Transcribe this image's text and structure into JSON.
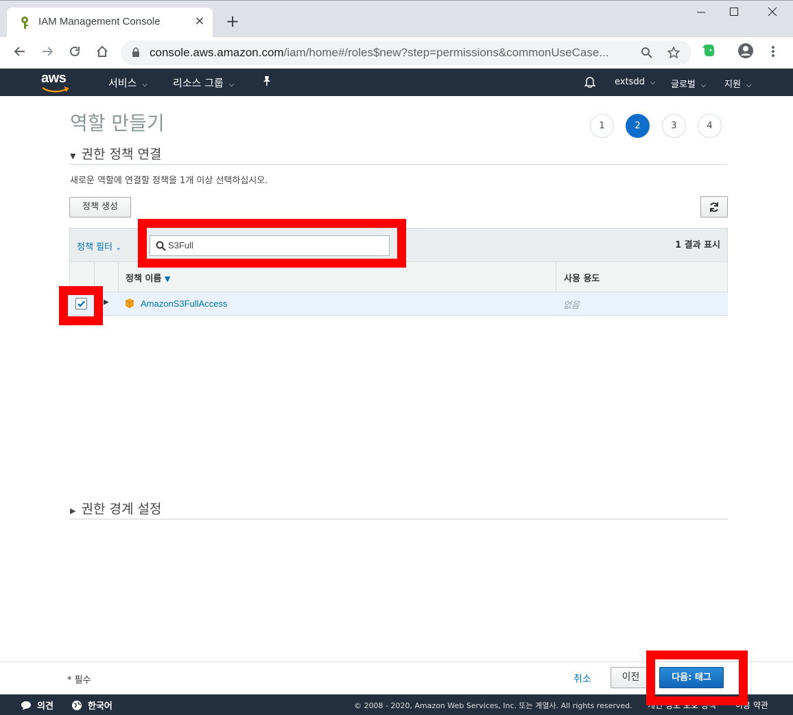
{
  "browser": {
    "tab_title": "IAM Management Console",
    "tab_close": "×",
    "new_tab": "+",
    "url_host": "console.aws.amazon.com",
    "url_path": "/iam/home#/roles$new?step=permissions&commonUseCase..."
  },
  "awsnav": {
    "logo": "aws",
    "services": "서비스",
    "resource_groups": "리소스 그룹",
    "account": "extsdd",
    "region": "글로벌",
    "support": "지원"
  },
  "page": {
    "title": "역할 만들기",
    "steps": [
      "1",
      "2",
      "3",
      "4"
    ],
    "active_step": 2,
    "section_permissions": "권한 정책 연결",
    "description": "새로운 역할에 연결할 정책을 1개 이상 선택하십시오.",
    "create_policy_button": "정책 생성",
    "filter_label": "정책 필터",
    "search_value": "S3Full",
    "result_count": "1 결과 표시",
    "columns": {
      "name": "정책 이름",
      "usage": "사용 용도"
    },
    "rows": [
      {
        "name": "AmazonS3FullAccess",
        "usage": "없음",
        "checked": true
      }
    ],
    "section_boundary": "권한 경계 설정"
  },
  "footer": {
    "required": "* 필수",
    "cancel": "취소",
    "previous": "이전",
    "next": "다음: 태그"
  },
  "bottombar": {
    "feedback": "의견",
    "language": "한국어",
    "copyright": "© 2008 - 2020, Amazon Web Services, Inc. 또는 계열사. All rights reserved.",
    "privacy": "개인 정보 보호 정책",
    "terms": "이용 약관"
  },
  "colors": {
    "aws_nav": "#232f3e",
    "primary_blue": "#0f6ec9",
    "link_blue": "#0073bb",
    "highlight_red": "#ff0000"
  }
}
